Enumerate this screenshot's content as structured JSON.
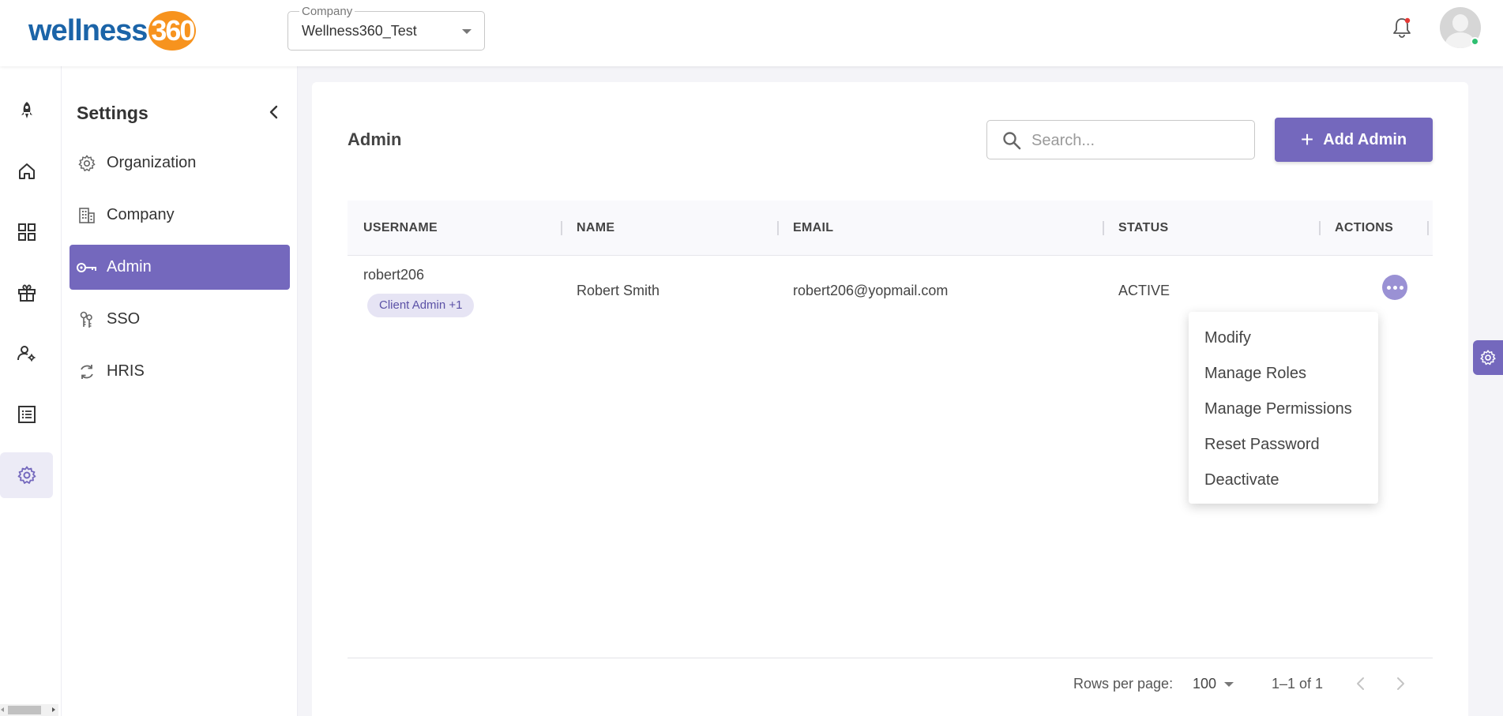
{
  "brand": {
    "word": "wellness",
    "num": "360"
  },
  "header": {
    "company_label": "Company",
    "company_value": "Wellness360_Test"
  },
  "colors": {
    "accent": "#7468bd",
    "accent_light": "#9a91d4",
    "brand_blue": "#1b64a8",
    "brand_orange": "#f7931e",
    "online": "#2fbf71",
    "notification": "#e53935"
  },
  "rail": {
    "items": [
      {
        "icon": "rocket-icon"
      },
      {
        "icon": "home-icon"
      },
      {
        "icon": "grid-icon"
      },
      {
        "icon": "gift-icon"
      },
      {
        "icon": "user-settings-icon"
      },
      {
        "icon": "list-icon"
      },
      {
        "icon": "gear-icon",
        "active": true
      }
    ]
  },
  "settings": {
    "title": "Settings",
    "items": [
      {
        "label": "Organization",
        "icon": "gear-icon"
      },
      {
        "label": "Company",
        "icon": "building-icon"
      },
      {
        "label": "Admin",
        "icon": "key-icon",
        "active": true
      },
      {
        "label": "SSO",
        "icon": "keys-icon"
      },
      {
        "label": "HRIS",
        "icon": "sync-icon"
      }
    ]
  },
  "main": {
    "title": "Admin",
    "search_placeholder": "Search...",
    "add_button": "Add Admin",
    "columns": [
      "USERNAME",
      "NAME",
      "EMAIL",
      "STATUS",
      "ACTIONS"
    ],
    "rows": [
      {
        "username": "robert206",
        "role_chip": "Client Admin +1",
        "name": "Robert Smith",
        "email": "robert206@yopmail.com",
        "status": "ACTIVE"
      }
    ],
    "footer": {
      "rows_per_page_label": "Rows per page:",
      "rows_per_page": "100",
      "range": "1–1 of 1"
    }
  },
  "action_menu": {
    "items": [
      "Modify",
      "Manage Roles",
      "Manage Permissions",
      "Reset Password",
      "Deactivate"
    ]
  }
}
